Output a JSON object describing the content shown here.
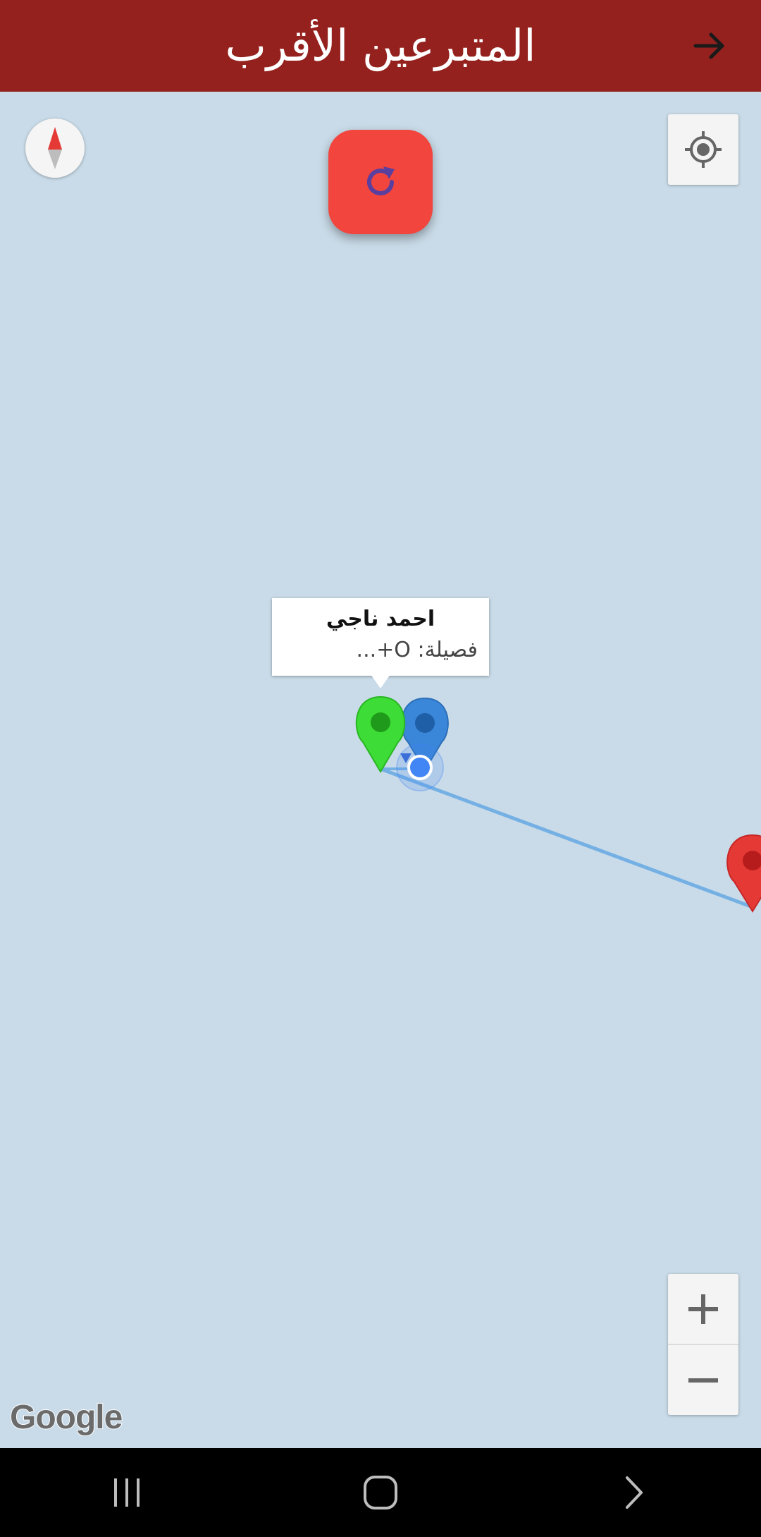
{
  "header": {
    "title": "المتبرعين الأقرب",
    "back_icon": "arrow-right-icon",
    "background_color": "#94211d"
  },
  "map": {
    "background_color": "#c9dbe8",
    "compass_icon": "compass-icon",
    "refresh_icon": "refresh-icon",
    "refresh_button_color": "#f2453d",
    "my_location_icon": "my-location-icon",
    "zoom_in_label": "+",
    "zoom_out_label": "−",
    "attribution": "Google",
    "info_window": {
      "name": "احمد ناجي",
      "detail": "فصيلة: O+..."
    },
    "markers": [
      {
        "name": "selected-donor-marker",
        "color": "#3ddc36"
      },
      {
        "name": "donor-marker-blue",
        "color": "#3a86d9"
      },
      {
        "name": "donor-marker-red",
        "color": "#e53935"
      }
    ],
    "route_color": "#74b0e4",
    "current_location_color": "#4285f4"
  },
  "system_nav": {
    "recents_icon": "recents-icon",
    "home_icon": "home-icon",
    "back_icon": "chevron-right-icon"
  }
}
